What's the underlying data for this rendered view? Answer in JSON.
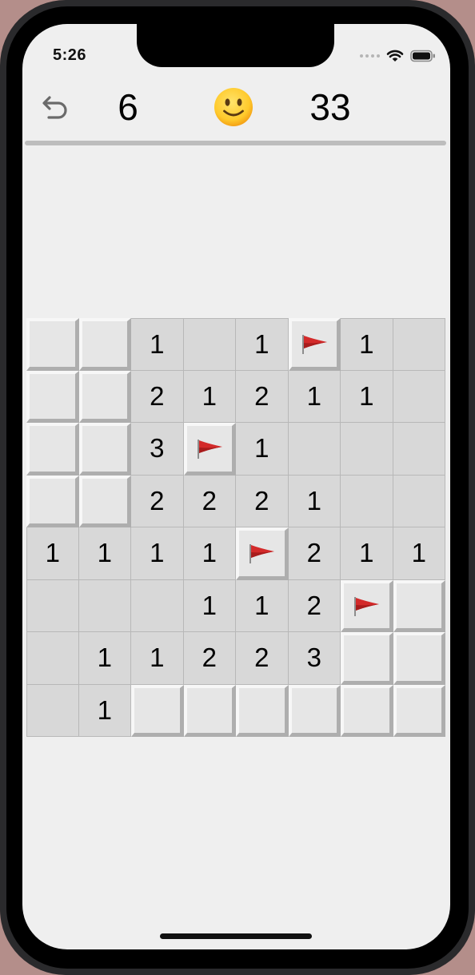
{
  "status_bar": {
    "time": "5:26",
    "icons": [
      "cellular-signal-icon",
      "wifi-icon",
      "battery-icon"
    ]
  },
  "header": {
    "undo_icon": "undo-arrow-icon",
    "mines_remaining": "6",
    "face": "🙂",
    "face_icon": "slightly-smiling-face-icon",
    "timer": "33"
  },
  "board": {
    "rows": 8,
    "cols": 8,
    "legend": {
      "H": "unrevealed",
      "F": "flagged",
      ".": "revealed-empty",
      "1-8": "revealed-number"
    },
    "flag_color": "#d32a2a",
    "cells": [
      [
        "H",
        "H",
        "1",
        ".",
        "1",
        "F",
        "1",
        "."
      ],
      [
        "H",
        "H",
        "2",
        "1",
        "2",
        "1",
        "1",
        "."
      ],
      [
        "H",
        "H",
        "3",
        "F",
        "1",
        ".",
        ".",
        "."
      ],
      [
        "H",
        "H",
        "2",
        "2",
        "2",
        "1",
        ".",
        "."
      ],
      [
        "1",
        "1",
        "1",
        "1",
        "F",
        "2",
        "1",
        "1"
      ],
      [
        ".",
        ".",
        ".",
        "1",
        "1",
        "2",
        "F",
        "H"
      ],
      [
        ".",
        "1",
        "1",
        "2",
        "2",
        "3",
        "H",
        "H"
      ],
      [
        ".",
        "1",
        "H",
        "H",
        "H",
        "H",
        "H",
        "H"
      ]
    ]
  }
}
